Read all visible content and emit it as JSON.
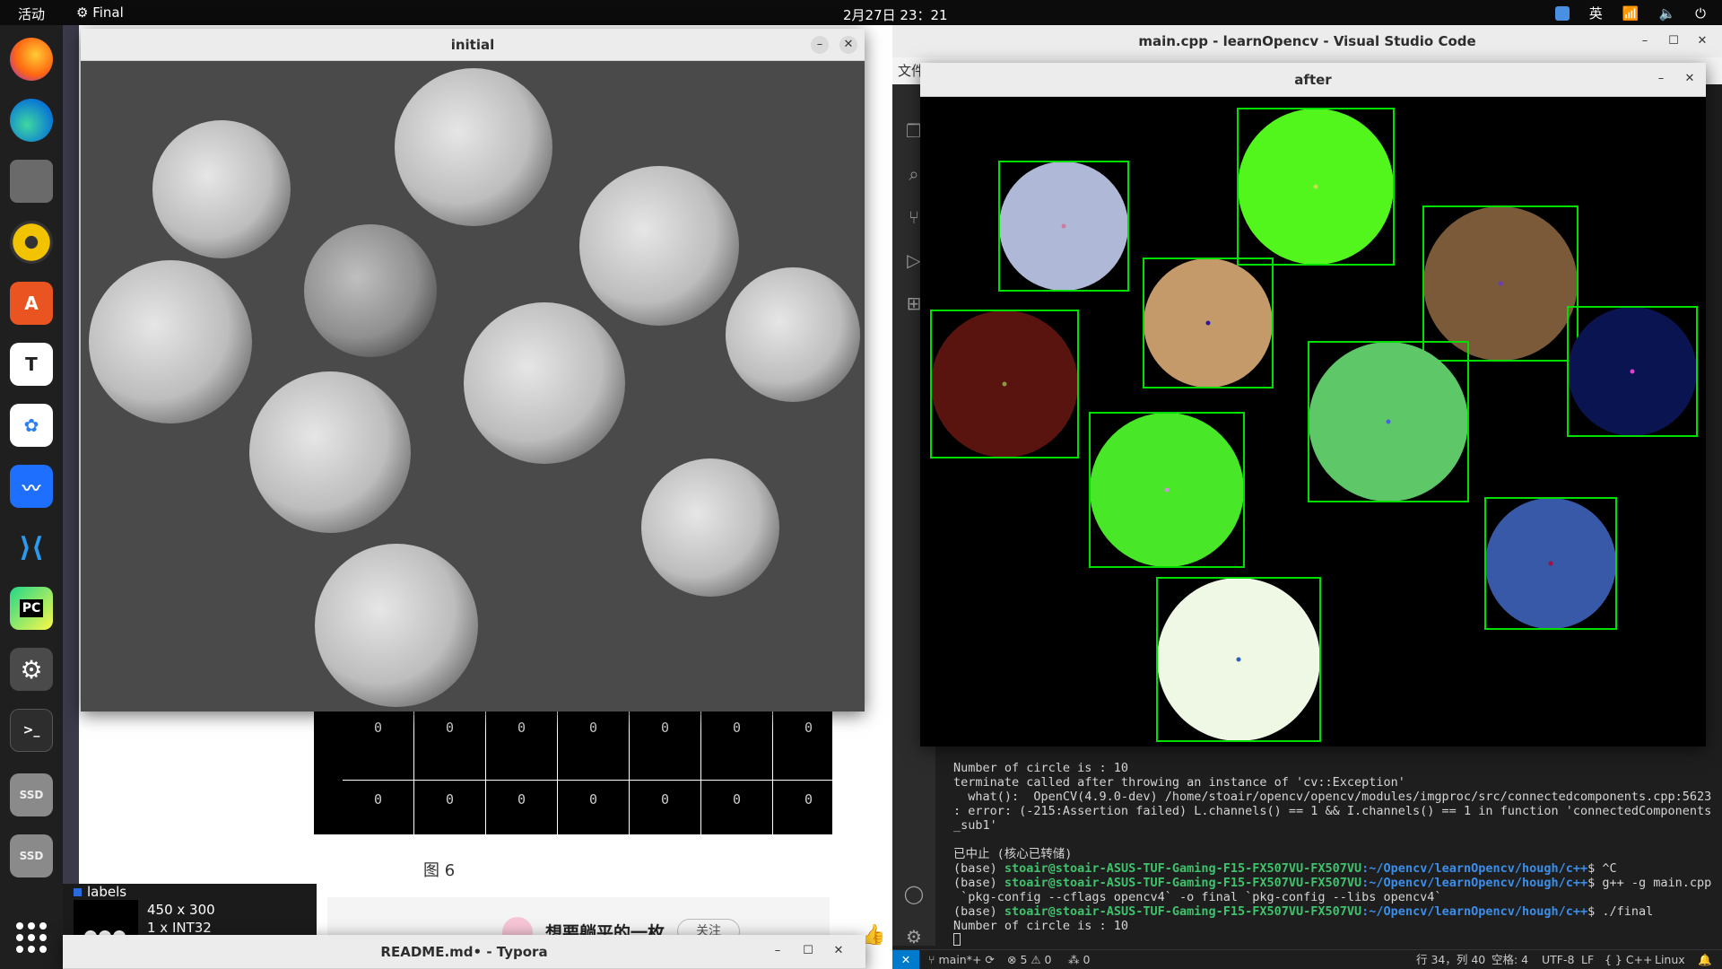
{
  "topbar": {
    "activities": "活动",
    "app_name": "Final",
    "clock": "2月27日 23：21",
    "input_method": "英"
  },
  "dock": {
    "items": [
      "firefox",
      "edge",
      "files",
      "rhythmbox",
      "app-center",
      "typora",
      "baidu-netdisk",
      "feishu",
      "vscode",
      "pycharm",
      "settings",
      "terminal",
      "ssd-1",
      "ssd-2"
    ],
    "pycharm_label": "PC",
    "ssd_label": "SSD"
  },
  "background_doc": {
    "figure_caption": "图 6",
    "matrix_values": [
      "0",
      "0",
      "0",
      "0",
      "0",
      "0",
      "0",
      "0",
      "0",
      "0",
      "0",
      "0",
      "0",
      "0"
    ],
    "panel_labels": "labels",
    "panel_size": "450 x 300",
    "panel_type": "1 x INT32",
    "blog_title": "想要躺平的一枚",
    "follow_label": "关注"
  },
  "initial_window": {
    "title": "initial"
  },
  "after_window": {
    "title": "after",
    "circles": [
      {
        "color": "#b0b8d8",
        "center": "#d07a9e"
      },
      {
        "color": "#52f51c",
        "center": "#c4e04a"
      },
      {
        "color": "#c59a6a",
        "center": "#2a1aa0"
      },
      {
        "color": "#7a5a38",
        "center": "#6a3ac0"
      },
      {
        "color": "#5a1410",
        "center": "#8a9a40"
      },
      {
        "color": "#0a1450",
        "center": "#e040d0"
      },
      {
        "color": "#5ec868",
        "center": "#4a60e0"
      },
      {
        "color": "#48e828",
        "center": "#d090e0"
      },
      {
        "color": "#3858a8",
        "center": "#a01040"
      },
      {
        "color": "#eff8e4",
        "center": "#3060c0"
      }
    ],
    "box_color": "#00e000"
  },
  "vscode": {
    "title": "main.cpp - learnOpencv - Visual Studio Code",
    "menu_first": "文件",
    "terminal": {
      "line1": "Number of circle is : 10",
      "line2": "terminate called after throwing an instance of 'cv::Exception'",
      "line3": "  what():  OpenCV(4.9.0-dev) /home/stoair/opencv/opencv/modules/imgproc/src/connectedcomponents.cpp:5623",
      "line4": ": error: (-215:Assertion failed) L.channels() == 1 && I.channels() == 1 in function 'connectedComponents",
      "line5": "_sub1'",
      "line6": "已中止 (核心已转储)",
      "p1_prefix": "(base) ",
      "user": "stoair@stoair-ASUS-TUF-Gaming-F15-FX507VU-FX507VU",
      "path": ":~/Opencv/learnOpencv/hough/c++",
      "p1_cmd": "$ ^C",
      "p2_cmd": "$ g++ -g main.cpp",
      "p2_cont": " `pkg-config --cflags opencv4` -o final `pkg-config --libs opencv4`",
      "p3_cmd": "$ ./final",
      "result": "Number of circle is : 10"
    },
    "statusbar": {
      "branch": "main*+",
      "problems": "⊗ 5 ⚠ 0",
      "ports": "⁂ 0",
      "position": "行 34，列 40",
      "spaces": "空格: 4",
      "encoding": "UTF-8",
      "eol": "LF",
      "language": "{ } C++",
      "os": "Linux"
    }
  },
  "typora_window": {
    "title": "README.md• - Typora"
  }
}
